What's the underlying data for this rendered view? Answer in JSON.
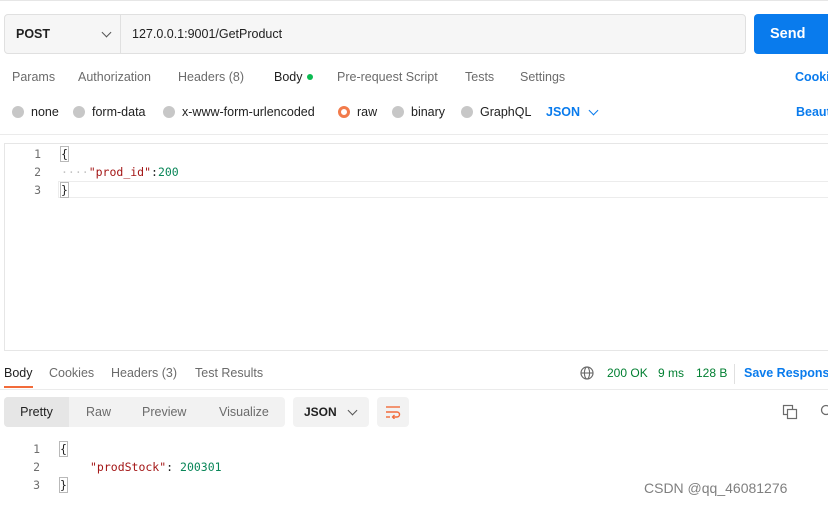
{
  "request": {
    "method": "POST",
    "url": "127.0.0.1:9001/GetProduct",
    "send_label": "Send"
  },
  "request_tabs": [
    {
      "label": "Params"
    },
    {
      "label": "Authorization"
    },
    {
      "label": "Headers (8)"
    },
    {
      "label": "Body"
    },
    {
      "label": "Pre-request Script"
    },
    {
      "label": "Tests"
    },
    {
      "label": "Settings"
    }
  ],
  "active_request_tab": "Body",
  "cookies_label": "Cooki",
  "body_types": [
    {
      "label": "none",
      "selected": false
    },
    {
      "label": "form-data",
      "selected": false
    },
    {
      "label": "x-www-form-urlencoded",
      "selected": false
    },
    {
      "label": "raw",
      "selected": true
    },
    {
      "label": "binary",
      "selected": false
    },
    {
      "label": "GraphQL",
      "selected": false
    }
  ],
  "raw_format": "JSON",
  "beautify_label": "Beaut",
  "request_body": {
    "line_numbers": [
      "1",
      "2",
      "3"
    ],
    "open_brace": "{",
    "indent_dots": "····",
    "key": "\"prod_id\"",
    "colon": ":",
    "value": "200",
    "close_brace": "}"
  },
  "response_tabs": [
    {
      "label": "Body"
    },
    {
      "label": "Cookies"
    },
    {
      "label": "Headers (3)"
    },
    {
      "label": "Test Results"
    }
  ],
  "active_response_tab": "Body",
  "response_meta": {
    "status": "200 OK",
    "time": "9 ms",
    "size": "128 B",
    "save_label": "Save Response"
  },
  "view_options": [
    {
      "label": "Pretty"
    },
    {
      "label": "Raw"
    },
    {
      "label": "Preview"
    },
    {
      "label": "Visualize"
    }
  ],
  "active_view": "Pretty",
  "response_format": "JSON",
  "response_body": {
    "line_numbers": [
      "1",
      "2",
      "3"
    ],
    "open_brace": "{",
    "key": "\"prodStock\"",
    "colon": ": ",
    "value": "200301",
    "close_brace": "}"
  },
  "watermark": "CSDN @qq_46081276",
  "colors": {
    "accent": "#097bed",
    "send_bg": "#097bed",
    "status_ok": "#007f31",
    "active_tab_underline": "#f26b3a",
    "raw_radio": "#f27b4b",
    "body_dot": "#0cbb52"
  },
  "icons": {
    "globe": "globe-icon",
    "wrap": "wrap-lines-icon",
    "copy": "copy-icon",
    "search": "search-icon"
  }
}
